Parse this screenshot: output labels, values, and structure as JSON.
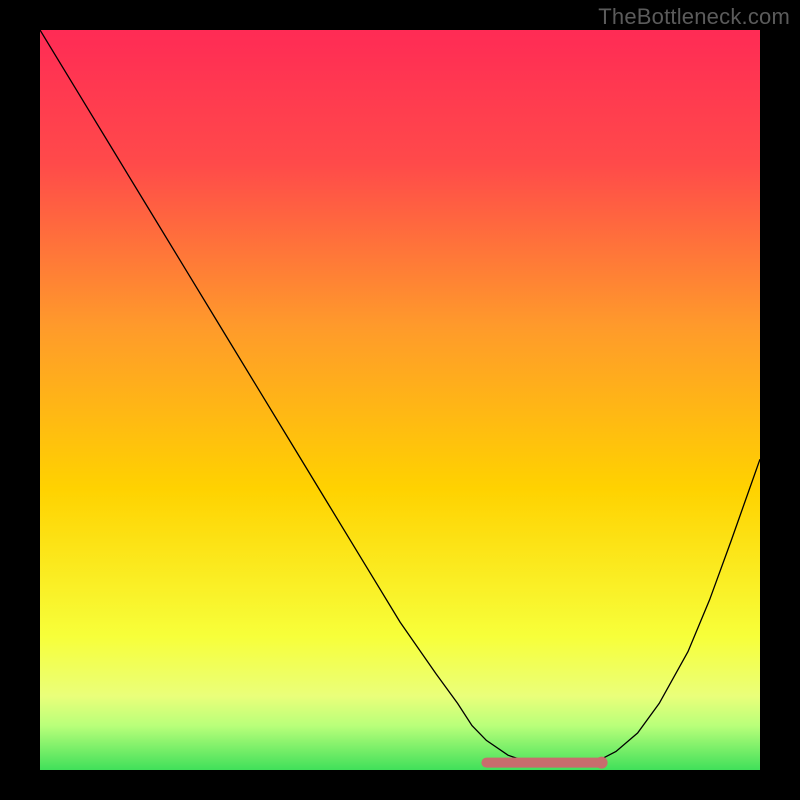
{
  "watermark": "TheBottleneck.com",
  "chart_data": {
    "type": "line",
    "title": "",
    "xlabel": "",
    "ylabel": "",
    "xlim": [
      0,
      100
    ],
    "ylim": [
      0,
      100
    ],
    "grid": false,
    "legend": false,
    "background_gradient": {
      "top": "#ff2b55",
      "mid": "#ffd200",
      "bottom_band": "#40e05a"
    },
    "series": [
      {
        "name": "bottleneck-curve",
        "x": [
          0,
          5,
          10,
          15,
          20,
          25,
          30,
          35,
          40,
          45,
          50,
          55,
          58,
          60,
          62,
          65,
          68,
          70,
          72,
          75,
          78,
          80,
          83,
          86,
          90,
          93,
          96,
          100
        ],
        "y": [
          100,
          92,
          84,
          76,
          68,
          60,
          52,
          44,
          36,
          28,
          20,
          13,
          9,
          6,
          4,
          2,
          1,
          0.8,
          0.8,
          1,
          1.5,
          2.5,
          5,
          9,
          16,
          23,
          31,
          42
        ]
      }
    ],
    "highlight_segment": {
      "x_start": 62,
      "x_end": 78,
      "y": 1,
      "end_dot_x": 78
    }
  }
}
